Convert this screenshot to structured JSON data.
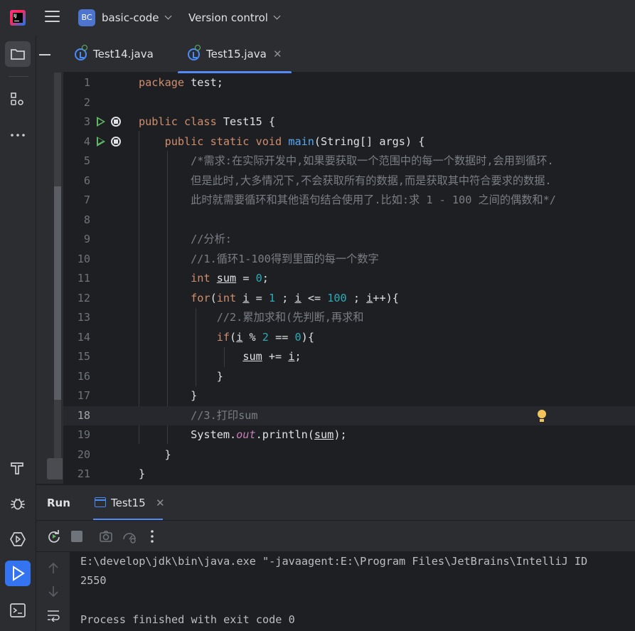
{
  "titlebar": {
    "project_badge": "BC",
    "project_name": "basic-code",
    "version_control": "Version control"
  },
  "tabs": [
    {
      "label": "Test14.java",
      "active": false
    },
    {
      "label": "Test15.java",
      "active": true
    }
  ],
  "editor": {
    "current_line": 18,
    "line_numbers": [
      "1",
      "2",
      "3",
      "4",
      "5",
      "6",
      "7",
      "8",
      "9",
      "10",
      "11",
      "12",
      "13",
      "14",
      "15",
      "16",
      "17",
      "18",
      "19",
      "20",
      "21"
    ]
  },
  "run_panel": {
    "title": "Run",
    "tab_label": "Test15",
    "console_lines": [
      "E:\\develop\\jdk\\bin\\java.exe \"-javaagent:E:\\Program Files\\JetBrains\\IntelliJ ID",
      "2550",
      "",
      "Process finished with exit code 0"
    ]
  },
  "colors": {
    "keyword": "#cf8e6d",
    "comment": "#7a7e85",
    "number": "#2aacb8",
    "function": "#56a8f5",
    "field": "#c77dbb",
    "accent": "#548af7",
    "run_green": "#5fb865"
  },
  "icons": [
    "jetbrains-logo-icon",
    "menu-icon",
    "folder-icon",
    "structure-icon",
    "more-icon",
    "build-icon",
    "debug-icon",
    "services-icon",
    "run-icon",
    "terminal-icon",
    "rerun-icon",
    "stop-icon",
    "screenshot-icon",
    "profiler-icon",
    "kebab-icon",
    "scroll-up-icon",
    "scroll-down-icon",
    "soft-wrap-icon",
    "lightbulb-icon"
  ]
}
